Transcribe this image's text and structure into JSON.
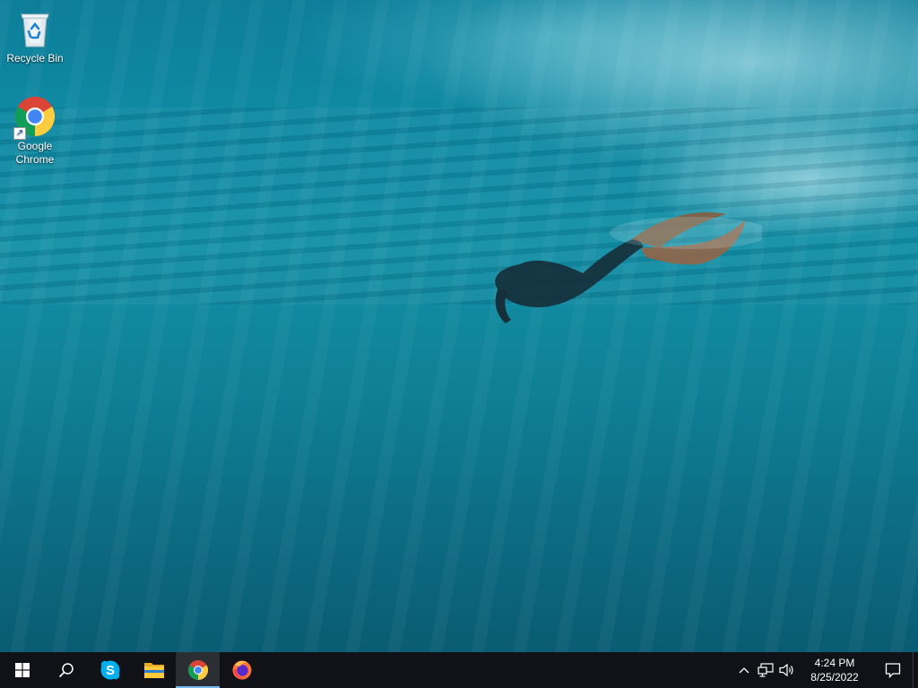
{
  "desktop": {
    "icons": [
      {
        "label": "Recycle Bin",
        "icon": "recycle-bin-icon"
      },
      {
        "label": "Google Chrome",
        "icon": "chrome-icon",
        "shortcut": true
      }
    ]
  },
  "taskbar": {
    "start": {
      "icon": "windows-start-icon"
    },
    "search": {
      "icon": "search-icon"
    },
    "pinned": [
      {
        "name": "Skype",
        "icon": "skype-icon",
        "active": false
      },
      {
        "name": "File Explorer",
        "icon": "file-explorer-icon",
        "active": false
      },
      {
        "name": "Google Chrome",
        "icon": "chrome-icon",
        "active": true
      },
      {
        "name": "Firefox",
        "icon": "firefox-icon",
        "active": false
      }
    ],
    "tray": {
      "icons": [
        "chevron-up-icon",
        "network-icon",
        "volume-icon"
      ],
      "time": "4:24 PM",
      "date": "8/25/2022",
      "notification_icon": "action-center-icon"
    }
  },
  "colors": {
    "taskbar_bg": "#101217",
    "active_indicator": "#76b9ed",
    "water_top": "#0d7e99",
    "water_bottom": "#0a5c72"
  }
}
